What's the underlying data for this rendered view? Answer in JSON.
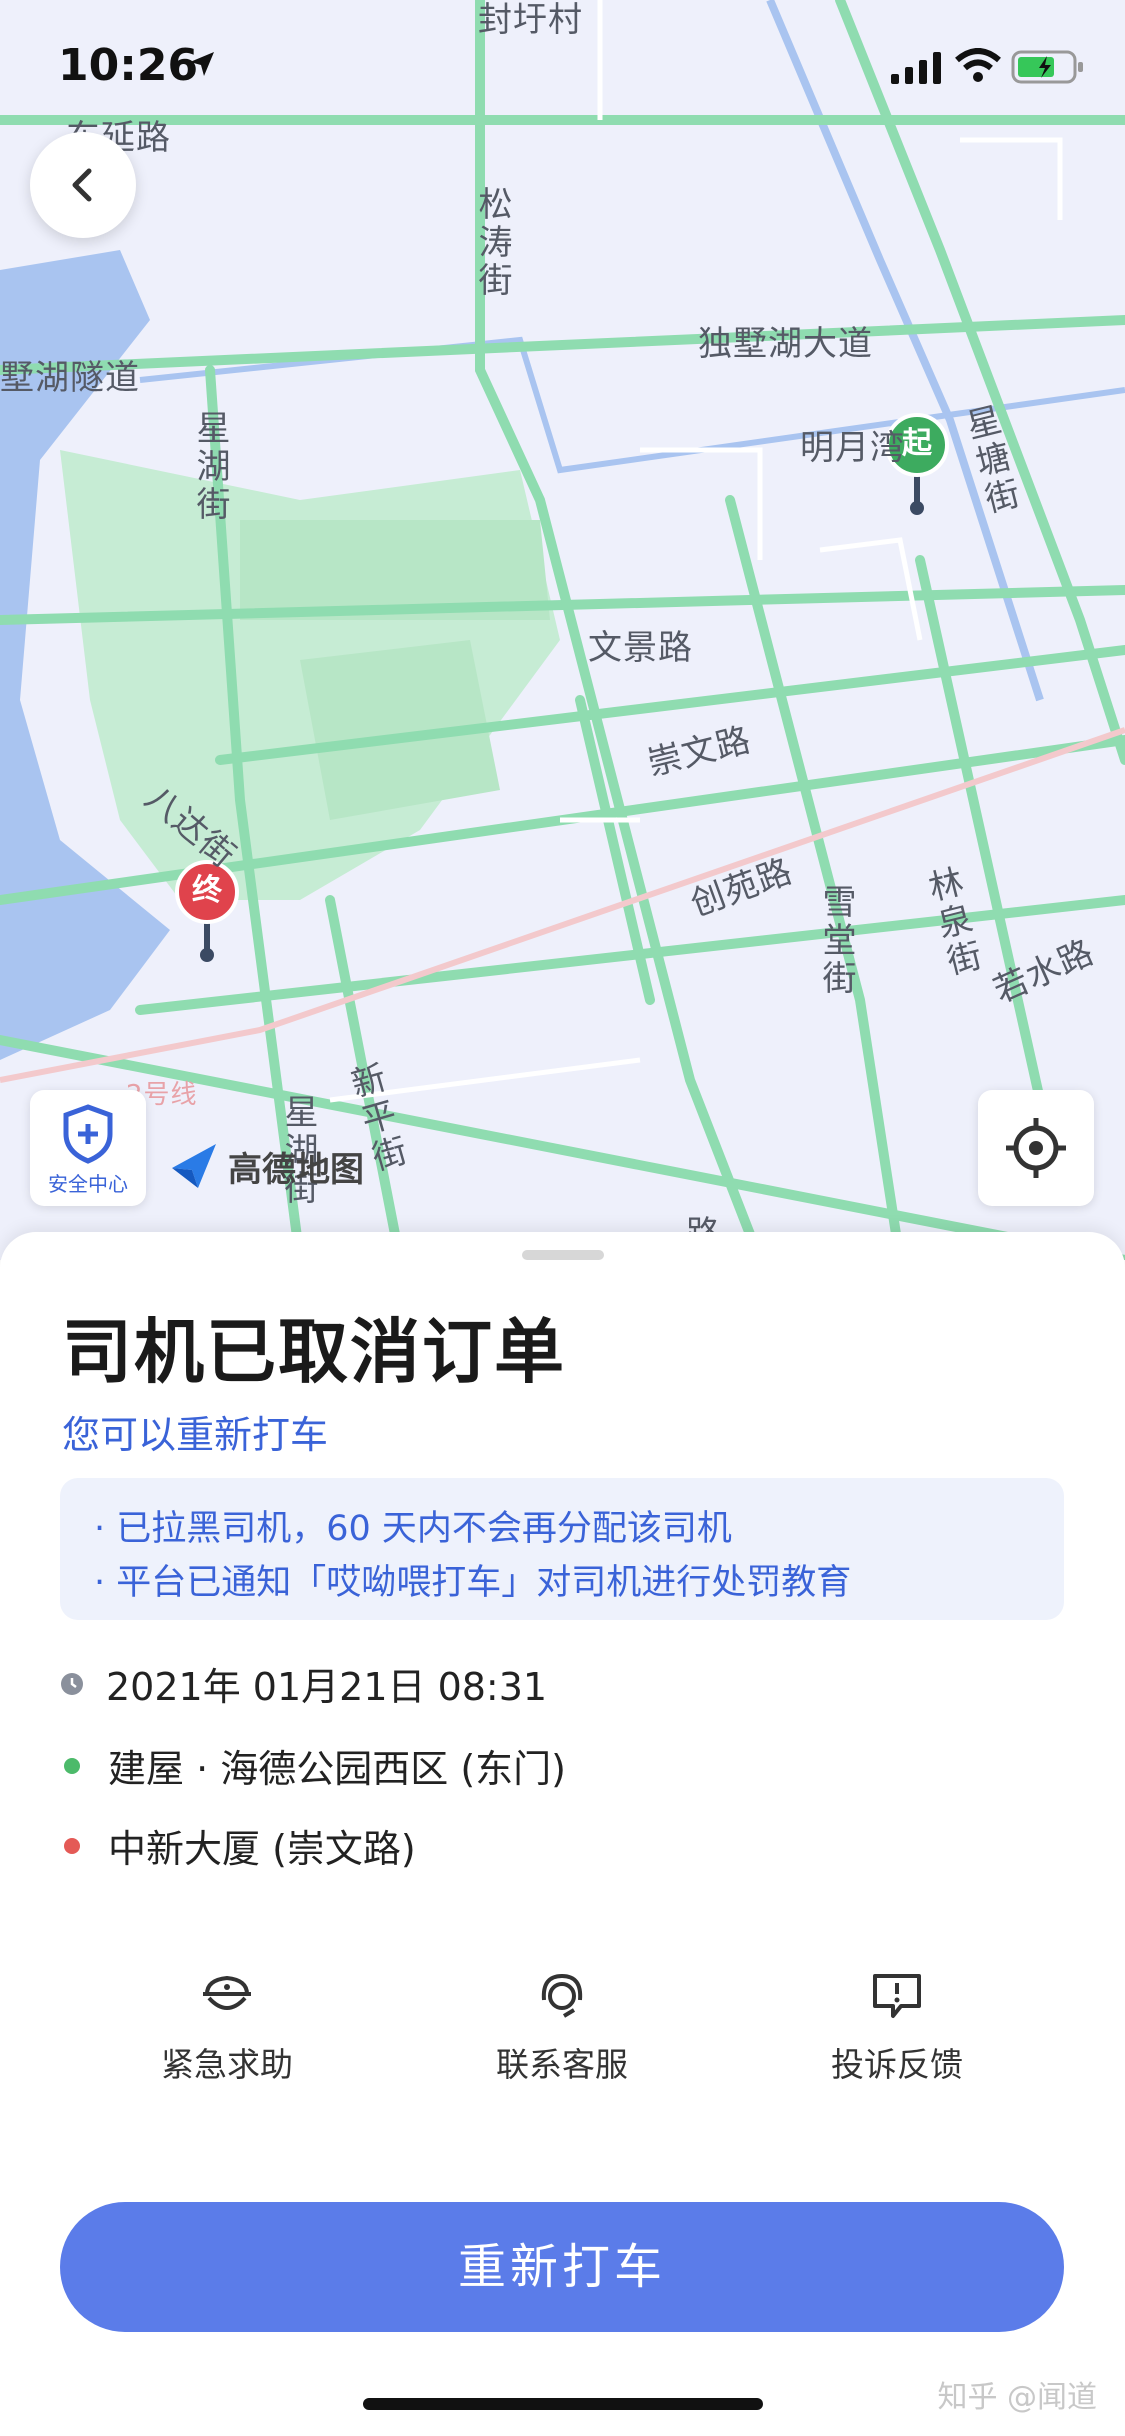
{
  "status_bar": {
    "time": "10:26"
  },
  "map": {
    "labels": {
      "fengshicun": "封圩村",
      "dongyanlu": "东延路",
      "songtaojie": "松涛街",
      "dushuhu_dadao": "独墅湖大道",
      "dushuhu_suidao": "墅湖隧道",
      "xinghujie": "星湖街",
      "mingyue": "明月湾",
      "xingtangjie": "星塘街",
      "wenjinglu": "文景路",
      "chongwenlu": "崇文路",
      "chuangyuanlu": "创苑路",
      "baguajie": "八达街",
      "xuetangjie": "雪堂街",
      "linquanjie": "林泉街",
      "ruoshuilu": "若水路",
      "line2": "2号线",
      "xinpingjie": "新平街",
      "xinghujie2": "星湖街",
      "bottom_road": "路"
    },
    "start_marker": "起",
    "end_marker": "终",
    "safety_center_label": "安全中心",
    "amap_brand": "高德地图"
  },
  "sheet": {
    "title": "司机已取消订单",
    "subtitle": "您可以重新打车",
    "notices": [
      "· 已拉黑司机，60 天内不会再分配该司机",
      "· 平台已通知「哎呦喂打车」对司机进行处罚教育"
    ],
    "time": "2021年 01月21日 08:31",
    "origin": "建屋 · 海德公园西区 (东门)",
    "destination": "中新大厦 (崇文路)",
    "actions": [
      {
        "label": "紧急求助",
        "icon": "police-icon"
      },
      {
        "label": "联系客服",
        "icon": "headset-icon"
      },
      {
        "label": "投诉反馈",
        "icon": "complaint-icon"
      }
    ],
    "cta_label": "重新打车",
    "watermark": "知乎 @闻道"
  },
  "colors": {
    "accent": "#3a63d8",
    "cta": "#5b7ce9",
    "origin_dot": "#4cba6a",
    "destination_dot": "#e45a56",
    "road_green": "#8fdcb0"
  }
}
